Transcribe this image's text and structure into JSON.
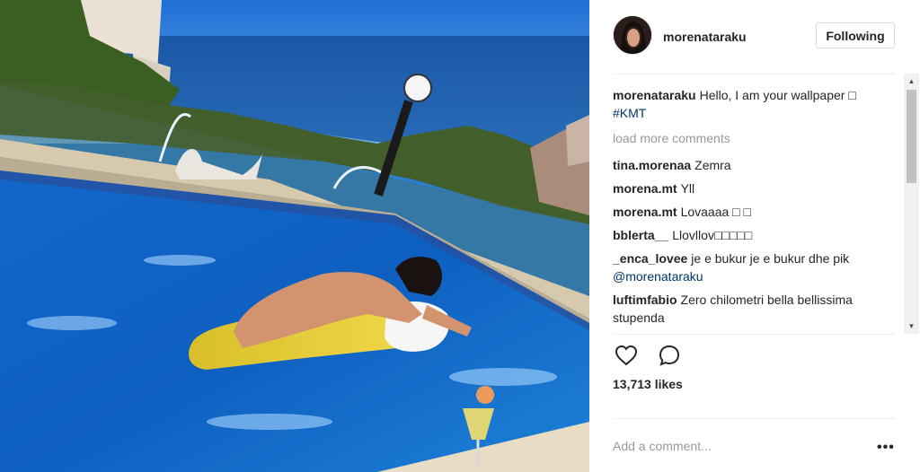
{
  "post": {
    "author": "morenataraku",
    "follow_label": "Following",
    "caption": {
      "user": "morenataraku",
      "text": "Hello, I am your wallpaper □",
      "hashtag": "#KMT"
    },
    "load_more_label": "load more comments",
    "comments": [
      {
        "user": "tina.morenaa",
        "text": "Zemra"
      },
      {
        "user": "morena.mt",
        "text": "Yll"
      },
      {
        "user": "morena.mt",
        "text": "Lovaaaa □ □"
      },
      {
        "user": "bblerta__",
        "text": "Llovllov□□□□□"
      },
      {
        "user": "_enca_lovee",
        "text": "je e bukur je e bukur dhe pik",
        "mention": "@morenataraku"
      },
      {
        "user": "luftimfabio",
        "text": "Zero chilometri bella bellissima stupenda"
      }
    ],
    "likes_label": "13,713 likes",
    "add_comment_placeholder": "Add a comment...",
    "more_options_label": "•••"
  },
  "icons": {
    "like": "heart-icon",
    "comment": "speech-bubble-icon",
    "more": "ellipsis-icon"
  },
  "colors": {
    "link": "#003569",
    "muted": "#999999",
    "text": "#262626",
    "border": "#dbdbdb"
  }
}
